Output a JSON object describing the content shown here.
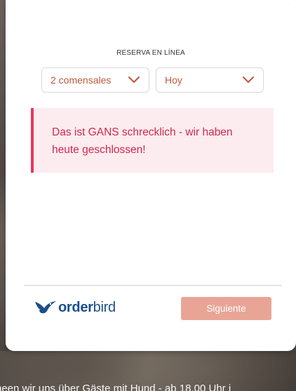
{
  "reservation": {
    "heading": "RESERVA EN LÍNEA",
    "guests": {
      "selected": "2 comensales",
      "icon": "chevron-down-icon"
    },
    "date": {
      "selected": "Hoy",
      "icon": "chevron-down-icon"
    },
    "alert": {
      "message": "Das ist GANS schrecklich - wir haben heute geschlossen!"
    }
  },
  "footer": {
    "logo": {
      "word_bold": "order",
      "word_light": "bird",
      "icon": "bird-icon"
    },
    "next_label": "Siguiente"
  },
  "background": {
    "caption": "neen wir uns über Gäste mit Hund - ab 18.00 Uhr i"
  },
  "colors": {
    "accent": "#c0583a",
    "alert_border": "#e8365a",
    "alert_text": "#d2264f",
    "alert_background": "#fdecef",
    "button_background": "#e8a596",
    "logo_blue": "#1c4f8c"
  }
}
